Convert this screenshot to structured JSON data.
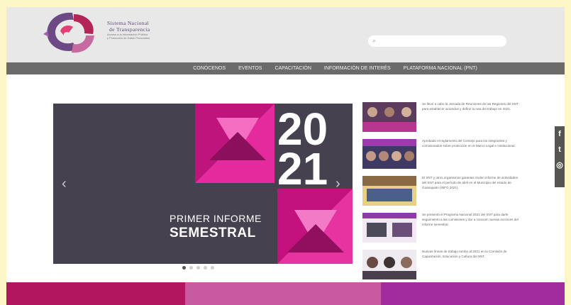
{
  "brand": {
    "line1": "Sistema Nacional",
    "line2": "de Transparencia",
    "line3": "Acceso a la Información Pública",
    "line4": "y Protección de Datos Personales"
  },
  "search": {
    "placeholder": ""
  },
  "nav": [
    "CONÓCENOS",
    "EVENTOS",
    "CAPACITACIÓN",
    "INFORMACIÓN DE INTERÉS",
    "PLATAFORMA NACIONAL (PNT)"
  ],
  "slide": {
    "year_top": "20",
    "year_bottom": "21",
    "subtitle_1": "PRIMER INFORME",
    "subtitle_2": "SEMESTRAL"
  },
  "news": [
    "Se llevó a cabo la Jornada de Reuniones de las Regiones del SNT para establecer acuerdos y definir la ruta del trabajo en 2021.",
    "Aprobado el reglamento del Consejo para los integrantes y comisionados sobre protección en el Marco Legal e Institucional.",
    "El SNT y otros organismos garantes rinden informe de actividades del SNT para el período de abril en el Municipio del estado de Guanajuato (INFO 2021).",
    "Se presentó el Programa Nacional 2021 del SNT para darle seguimiento a las comisiones y dar a conocer nuevas acciones del informe semestral.",
    "Nuevas líneas de trabajo rumbo al 2021 en la Comisión de Capacitación, Educación y Cultura del SNT."
  ],
  "colors": {
    "band1": "#b2165f",
    "band2": "#c85aa2",
    "band3": "#a02c9e",
    "nav": "#6b6b6b",
    "accent": "#e01e8c"
  },
  "icons": [
    "facebook-icon",
    "twitter-icon",
    "instagram-icon",
    "search-icon",
    "chevron-left-icon",
    "chevron-right-icon"
  ]
}
